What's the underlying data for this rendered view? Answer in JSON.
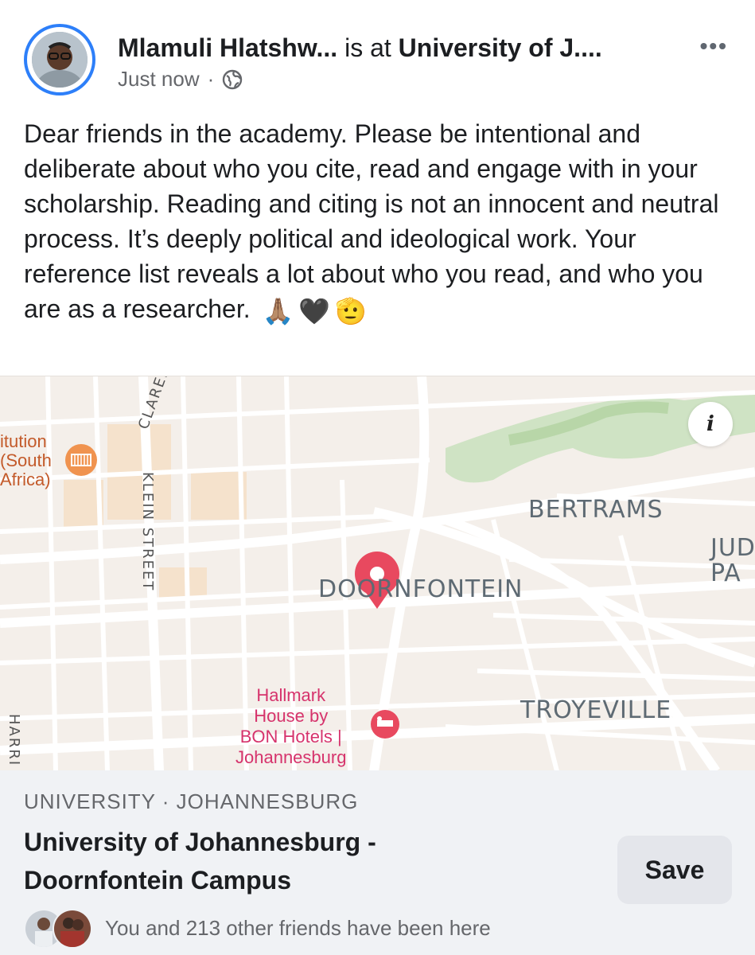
{
  "post": {
    "author": "Mlamuli Hlatshw...",
    "connector": " is at ",
    "location": "University of J....",
    "time": "Just now",
    "separator": "·",
    "more_label": "•••",
    "text": "Dear friends in the academy. Please be intentional and deliberate about who you cite, read and engage with in your scholarship. Reading and citing is not an innocent and neutral process. It’s deeply political and ideological work. Your reference list reveals a lot about who you read, and who you are as a researcher. ",
    "emojis": [
      "🙏🏽",
      "🖤",
      "🫡"
    ]
  },
  "map": {
    "labels": {
      "institution": "itution\n(South\nAfrica)",
      "bertrams": "BERTRAMS",
      "doornfontein": "DOORNFONTEIN",
      "judith": "JUD\nPA",
      "troyeville": "TROYEVILLE",
      "hotel": "Hallmark\nHouse by\nBON Hotels |\nJohannesburg",
      "klein_street": "KLEIN STREET",
      "claren": "CLAREN",
      "harri": "HARRI"
    },
    "info_label": "i"
  },
  "place": {
    "category": "UNIVERSITY · JOHANNESBURG",
    "name": "University of Johannesburg - Doornfontein Campus",
    "save_label": "Save",
    "friends_text": "You and 213 other friends have been here"
  },
  "colors": {
    "accent": "#2d7ff9",
    "pin": "#e8495f",
    "park": "#cfe3c4",
    "map_bg": "#f4efea"
  }
}
